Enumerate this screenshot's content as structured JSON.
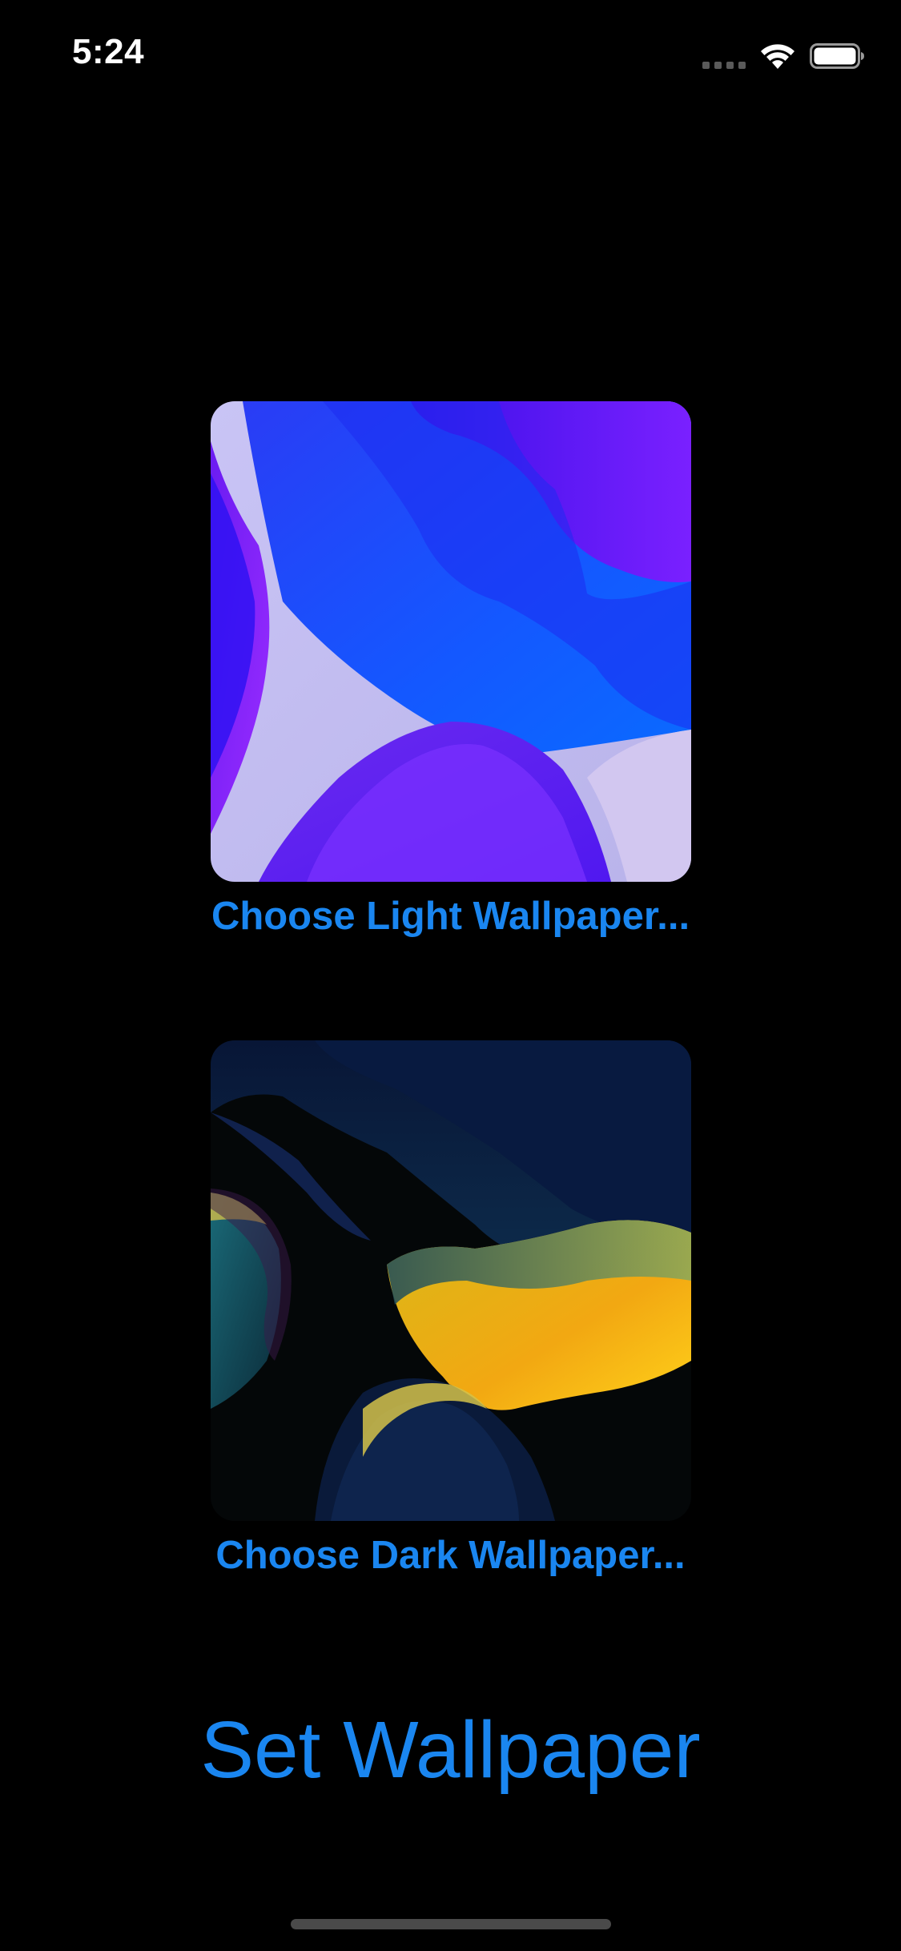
{
  "status_bar": {
    "time": "5:24",
    "icons": [
      "cellular-signal-icon",
      "wifi-icon",
      "battery-icon"
    ]
  },
  "light_wallpaper": {
    "choose_label": "Choose Light Wallpaper..."
  },
  "dark_wallpaper": {
    "choose_label": "Choose Dark Wallpaper..."
  },
  "actions": {
    "set_label": "Set Wallpaper"
  },
  "colors": {
    "background": "#000000",
    "accent": "#1a86f0"
  }
}
